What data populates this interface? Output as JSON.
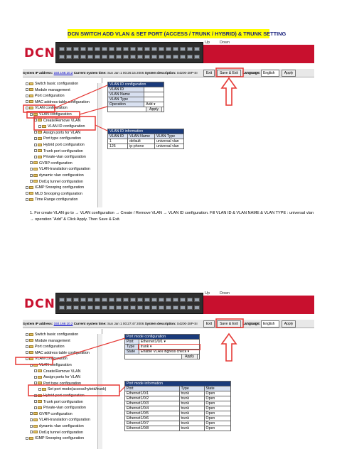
{
  "doc_title": "DCN SWITCH ADD VLAN & SET PORT (ACCESS / TRUNK / HYBRID) & TRUNK SETTING",
  "logo": "DCN",
  "updown": {
    "up": "Up",
    "down": "Down"
  },
  "status1": {
    "ip_label": "System IP address:",
    "ip_value": "192.168.10.2",
    "time_label": "Current system time:",
    "time_value": "Sun Jan 1 00:26:15 2006",
    "desc_label": "System description:",
    "desc_value": "S4200-28P-SI",
    "exit": "Exit",
    "save": "Save & Exit",
    "lang_label": "Language:",
    "lang_value": "English",
    "apply": "Apply"
  },
  "status2": {
    "ip_label": "System IP address:",
    "ip_value": "192.168.10.2",
    "time_label": "Current system time:",
    "time_value": "Sun Jan 1 00:27:47 2006",
    "desc_label": "System description:",
    "desc_value": "S4200-28P-SI",
    "exit": "Exit",
    "save": "Save & Exit",
    "lang_label": "Language:",
    "lang_value": "English",
    "apply": "Apply"
  },
  "tree1": [
    "Switch basic configuration",
    "Module management",
    "Port configuration",
    "MAC address table configuration",
    "VLAN configuration",
    "VLAN configuration",
    "Create/Remove VLAN",
    "VLAN ID configuration",
    "Assign ports for VLAN",
    "Port type configuration",
    "Hybrid port configuration",
    "Trunk port configuration",
    "Private-vlan configuration",
    "GVRP configuration",
    "VLAN-translation configuration",
    "dynamic vlan configuration",
    "Dot1q tunnel configuration",
    "IGMP Snooping configuration",
    "MLD Snooping configuration",
    "Time Range configuration"
  ],
  "tree2": [
    "Switch basic configuration",
    "Module management",
    "Port configuration",
    "MAC address table configuration",
    "VLAN configuration",
    "VLAN configuration",
    "Create/Remove VLAN",
    "Assign ports for VLAN",
    "Port type configuration",
    "Set port mode(access/hybrid/trunk)",
    "Hybrid port configuration",
    "Trunk port configuration",
    "Private-vlan configuration",
    "GVRP configuration",
    "VLAN-translation configuration",
    "dynamic vlan configuration",
    "Dot1q tunnel configuration",
    "IGMP Snooping configuration"
  ],
  "vlan_cfg": {
    "title": "VLAN ID configuration",
    "id_label": "VLAN ID",
    "name_label": "VLAN Name",
    "type_label": "VLAN Type",
    "op_label": "Operation",
    "op_value": "Add",
    "apply": "Apply"
  },
  "vlan_info": {
    "title": "VLAN ID information",
    "headers": [
      "VLAN ID",
      "VLAN Name",
      "VLAN Type"
    ],
    "rows": [
      [
        "1",
        "default",
        "universal vlan"
      ],
      [
        "126",
        "ip-phone",
        "universal vlan"
      ]
    ]
  },
  "note": "1. For create VLAN go to → VLAN configuration → Create / Remove VLAN → VLAN ID configuration. Fill VLAN ID & VLAN NAME & VLAN TYPE : universal vlan → operation “Add” & Click Apply. Then Save & Exit.",
  "port_cfg": {
    "title": "Port mode configuration",
    "port_label": "Port",
    "port_value": "Ethernet1/0/1",
    "type_label": "Type",
    "type_value": "trunk",
    "state_label": "State",
    "state_value": "Enable VLAN ingress check",
    "apply": "Apply"
  },
  "port_info": {
    "title": "Port mode information",
    "headers": [
      "Port",
      "Type",
      "State"
    ],
    "rows": [
      [
        "Ethernet1/0/1",
        "trunk",
        "Open"
      ],
      [
        "Ethernet1/0/2",
        "trunk",
        "Open"
      ],
      [
        "Ethernet1/0/3",
        "trunk",
        "Open"
      ],
      [
        "Ethernet1/0/4",
        "trunk",
        "Open"
      ],
      [
        "Ethernet1/0/5",
        "trunk",
        "Open"
      ],
      [
        "Ethernet1/0/6",
        "trunk",
        "Open"
      ],
      [
        "Ethernet1/0/7",
        "trunk",
        "Open"
      ],
      [
        "Ethernet1/0/8",
        "trunk",
        "Open"
      ]
    ]
  }
}
